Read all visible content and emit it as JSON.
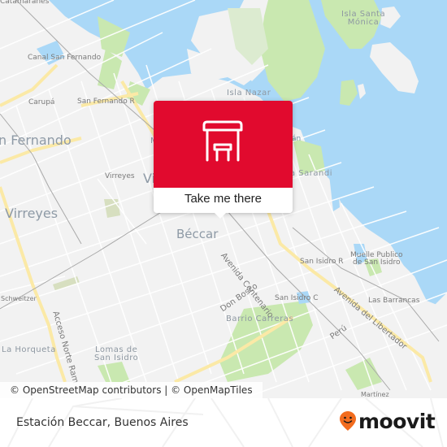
{
  "popup": {
    "icon": "bus-stop-icon",
    "action_label": "Take me there",
    "color": "#e10a2e"
  },
  "map": {
    "colors": {
      "land": "#f2f2f2",
      "water": "#aad8f7",
      "park": "#c9e8b0",
      "major_road": "#fbe9a6",
      "street": "#ffffff",
      "rail": "#a9a9a9"
    },
    "labels": {
      "catamaranes": "Catamaranes",
      "canal_san_fernando": "Canal San Fernando",
      "carupa": "Carupá",
      "san_fernando_r": "San Fernando R",
      "san_fernando": "n Fernando",
      "virreyes_station": "Virreyes",
      "virreyes_area": "Virreyes",
      "victoria_partial": "Vi",
      "m_partial": "M",
      "isla_santa_monica_1": "Isla Santa",
      "isla_santa_monica_2": "Mónica",
      "isla_nazar": "Isla Nazar",
      "an_partial": "án",
      "sarandi_partial": "a Sarandi",
      "beccar": "Béccar",
      "avenida_centenario": "Avenida Centenario",
      "san_isidro_r": "San Isidro R",
      "muelle_1": "Muelle Publico",
      "muelle_2": "de San Isidro",
      "don_bosco": "Don Bosco",
      "san_isidro_c": "San Isidro C",
      "las_barrancas": "Las Barrancas",
      "avenida_del_libertador": "Avenida del Libertador",
      "barrio_carreras": "Barrio Carreras",
      "peru": "Perú",
      "schweitzer": "Schweitzer",
      "acceso_norte": "Acceso Norte Ram",
      "la_horqueta": "La Horqueta",
      "lomas_1": "Lomas de",
      "lomas_2": "San Isidro",
      "martinez": "Martínez"
    },
    "attribution": "© OpenStreetMap contributors | © OpenMapTiles"
  },
  "footer": {
    "title": "Estación Beccar, Buenos Aires",
    "brand": "moovit",
    "brand_icon": "moovit-pin-smile-icon",
    "brand_color": "#f26c1e"
  }
}
